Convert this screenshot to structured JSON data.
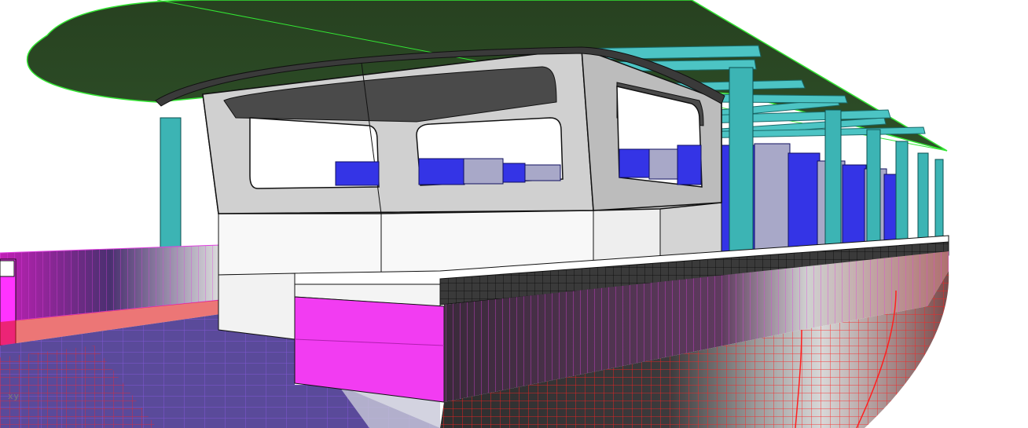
{
  "viewport": {
    "axis_label": "xy"
  },
  "model": {
    "objects": [
      {
        "name": "canopy-roof",
        "color": "#2c4a26",
        "edge_color": "#33e633"
      },
      {
        "name": "cabin-superstructure",
        "color": "#d8d8d8",
        "edge_color": "#111111"
      },
      {
        "name": "seat-block",
        "color": "#3434e6"
      },
      {
        "name": "seat-panel",
        "color": "#a8a8c8"
      },
      {
        "name": "roof-support-pillar",
        "color": "#3cb4b4"
      },
      {
        "name": "roof-beam",
        "color": "#4cc4c4"
      },
      {
        "name": "hull-deck-side",
        "color": "#e83ce8"
      },
      {
        "name": "hull-bottom",
        "color": "#e01a1a"
      },
      {
        "name": "hull-mesh-dark",
        "color": "#3a3a3a"
      },
      {
        "name": "bow-deck",
        "color": "#5a4a9a"
      }
    ]
  }
}
